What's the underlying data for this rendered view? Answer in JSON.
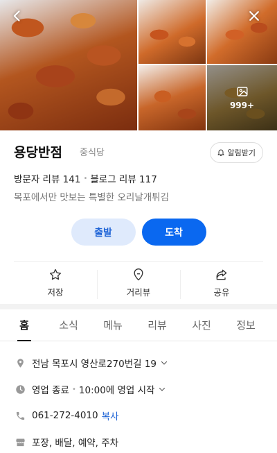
{
  "header": {
    "more_photos_count": "999+"
  },
  "place": {
    "name": "용당반점",
    "category": "중식당",
    "alarm_label": "알림받기",
    "visitor_reviews": "방문자 리뷰 141",
    "blog_reviews": "블로그 리뷰 117",
    "description": "목포에서만 맛보는 특별한 오리날개튀김"
  },
  "route": {
    "start_label": "출발",
    "arrive_label": "도착"
  },
  "actions": {
    "save_label": "저장",
    "street_view_label": "거리뷰",
    "share_label": "공유"
  },
  "tabs": [
    {
      "label": "홈"
    },
    {
      "label": "소식"
    },
    {
      "label": "메뉴"
    },
    {
      "label": "리뷰"
    },
    {
      "label": "사진"
    },
    {
      "label": "정보"
    }
  ],
  "details": {
    "address": "전남 목포시 영산로270번길 19",
    "hours_status": "영업 종료",
    "hours_next": "10:00에 영업 시작",
    "phone": "061-272-4010",
    "copy_label": "복사",
    "services": "포장, 배달, 예약, 주차"
  },
  "colors": {
    "accent": "#0a68f0",
    "start_bg": "#dfeafc",
    "start_text": "#1e63d6"
  }
}
